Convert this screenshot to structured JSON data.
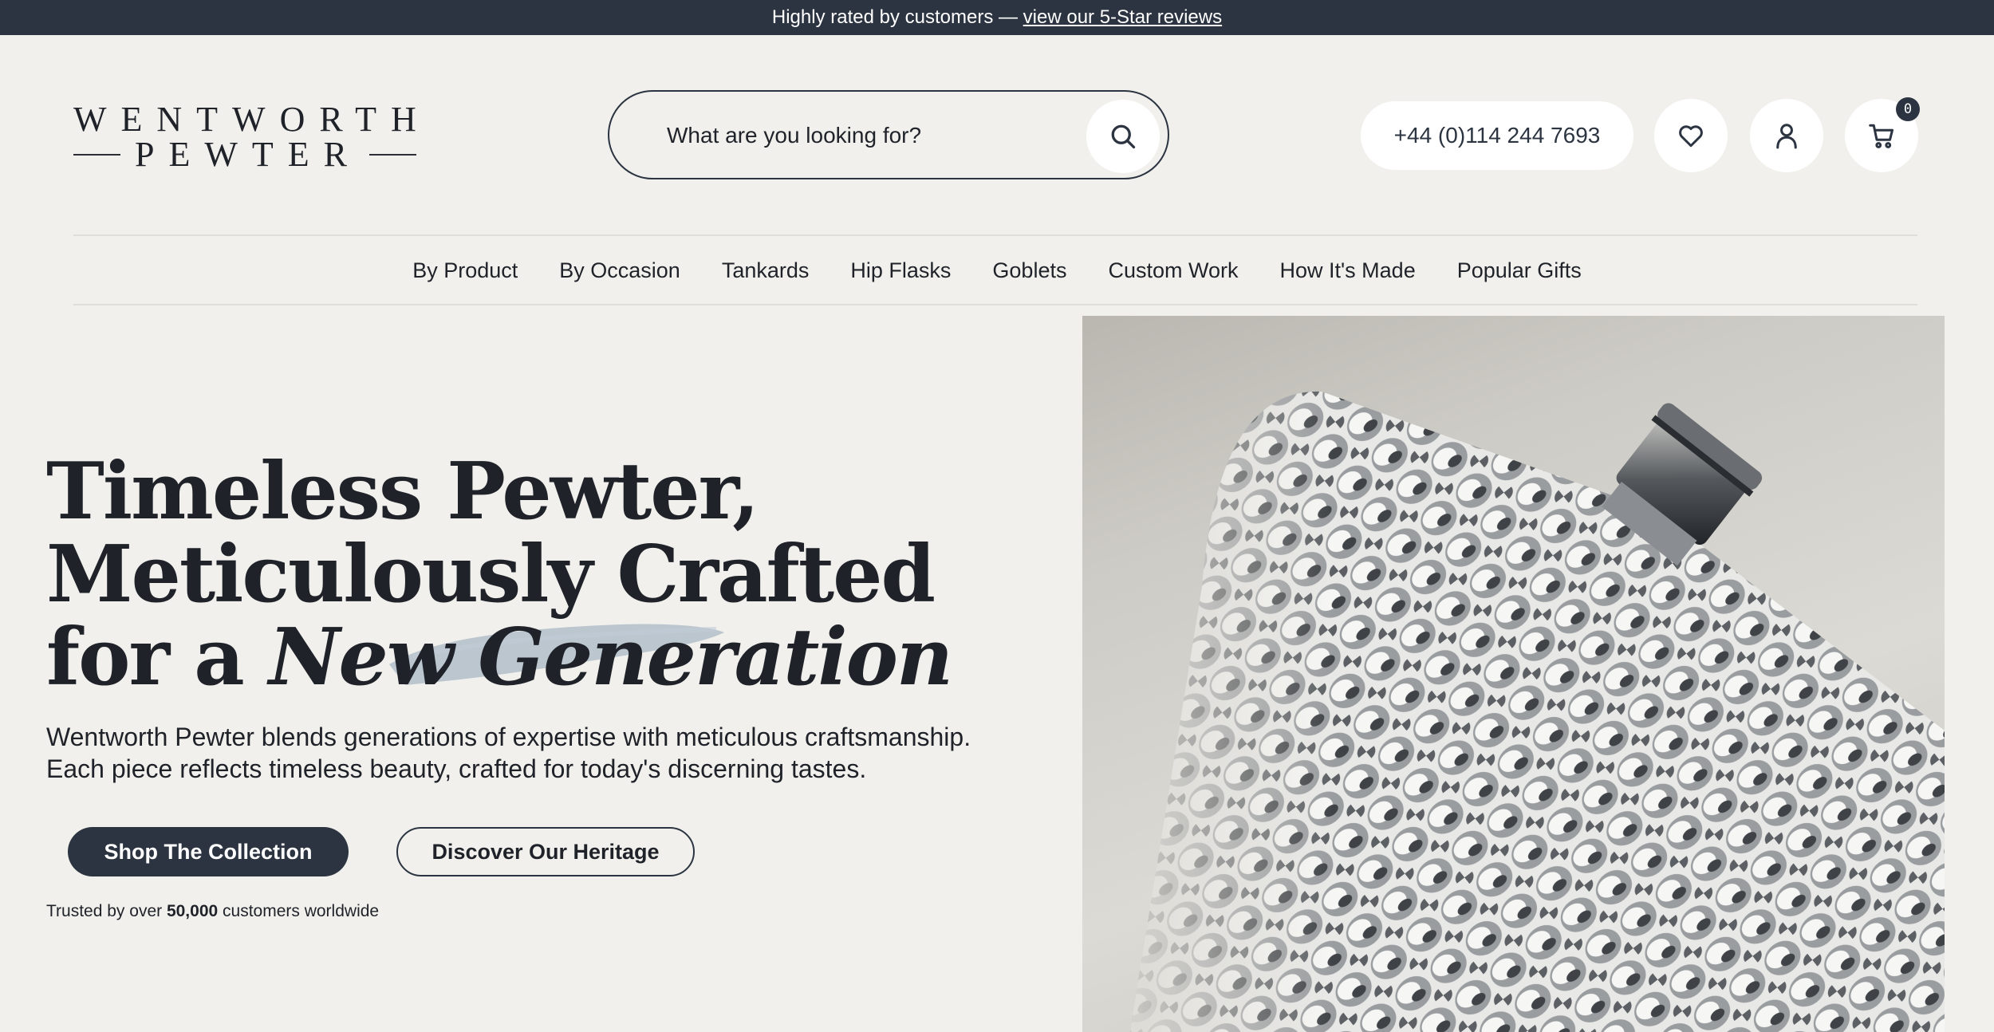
{
  "announcement": {
    "text": "Highly rated by customers — ",
    "link": "view our 5-Star reviews"
  },
  "logo": {
    "line1": "WENTWORTH",
    "line2": "PEWTER"
  },
  "search": {
    "placeholder": "What are you looking for?",
    "icon": "search-icon"
  },
  "header": {
    "phone": "+44 (0)114 244 7693",
    "wishlist_icon": "heart-icon",
    "account_icon": "user-icon",
    "cart_icon": "cart-icon",
    "cart_count": "0"
  },
  "nav": {
    "items": [
      "By Product",
      "By Occasion",
      "Tankards",
      "Hip Flasks",
      "Goblets",
      "Custom Work",
      "How It's Made",
      "Popular Gifts"
    ]
  },
  "hero": {
    "line1": "Timeless Pewter,",
    "line2": "Meticulously Crafted",
    "line3_prefix": "for a ",
    "line3_italic": "New Generation",
    "subtitle_line1": "Wentworth Pewter blends generations of expertise with meticulous craftsmanship.",
    "subtitle_line2": "Each piece reflects timeless beauty, crafted for today's discerning tastes.",
    "primary_button": "Shop The Collection",
    "secondary_button": "Discover Our Heritage",
    "trust_prefix": "Trusted by over ",
    "trust_number": "50,000",
    "trust_suffix": " customers worldwide",
    "image_alt": "hammered pewter hip flask"
  },
  "colors": {
    "background": "#f1f0ec",
    "navy": "#2b3440",
    "brush": "#a9b8c6"
  }
}
